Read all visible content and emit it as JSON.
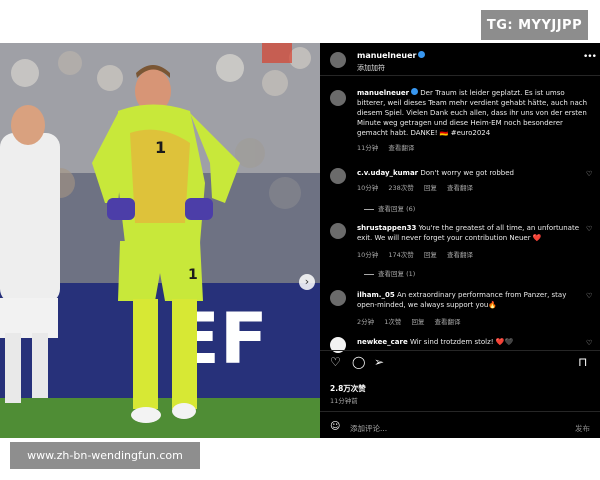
{
  "badge": {
    "text": "TG: MYYJJPP"
  },
  "post": {
    "username": "manuelneuer",
    "subtitle": "添加加符",
    "more": "•••",
    "caption": {
      "username": "manuelneuer",
      "text": "Der Traum ist leider geplatzt. Es ist umso bitterer, weil dieses Team mehr verdient gehabt hätte, auch nach diesem Spiel. Vielen Dank euch allen, dass ihr uns von der ersten Minute weg getragen und diese Heim-EM noch besonderer gemacht habt. DANKE! 🇩🇪 #euro2024",
      "time": "11分钟",
      "translate": "查看翻译"
    },
    "comments": [
      {
        "username": "c.v.uday_kumar",
        "text": "Don't worry we got robbed",
        "time": "10分钟",
        "likes": "238次赞",
        "reply": "回复",
        "translate": "查看翻译",
        "view_replies": "查看回复 (6)"
      },
      {
        "username": "shrustappen33",
        "text": "You're the greatest of all time, an unfortunate exit. We will never forget your contribution Neuer ❤️",
        "time": "10分钟",
        "likes": "174次赞",
        "reply": "回复",
        "translate": "查看翻译",
        "view_replies": "查看回复 (1)"
      },
      {
        "username": "ilham._05",
        "text": "An extraordinary performance from Panzer, stay open-minded, we always support you🔥",
        "time": "2分钟",
        "likes": "1次赞",
        "reply": "回复",
        "translate": "查看翻译"
      },
      {
        "username": "newkee_care",
        "text": "Wir sind trotzdem stolz! ❤️🖤",
        "time": "",
        "likes": "",
        "reply": "",
        "translate": ""
      }
    ],
    "likes_count": "2.8万次赞",
    "time_ago": "11分钟前",
    "add_comment_placeholder": "添加评论...",
    "post_button": "发布"
  },
  "icons": {
    "like": "heart-icon",
    "comment": "comment-icon",
    "share": "send-icon",
    "save": "bookmark-icon",
    "emoji": "emoji-icon",
    "carousel": "chevron-right-icon"
  },
  "colors": {
    "bg": "#000000",
    "jersey": "#c8e83a",
    "sky": "#39435c"
  },
  "watermark": {
    "text": "www.zh-bn-wendingfun.com"
  }
}
